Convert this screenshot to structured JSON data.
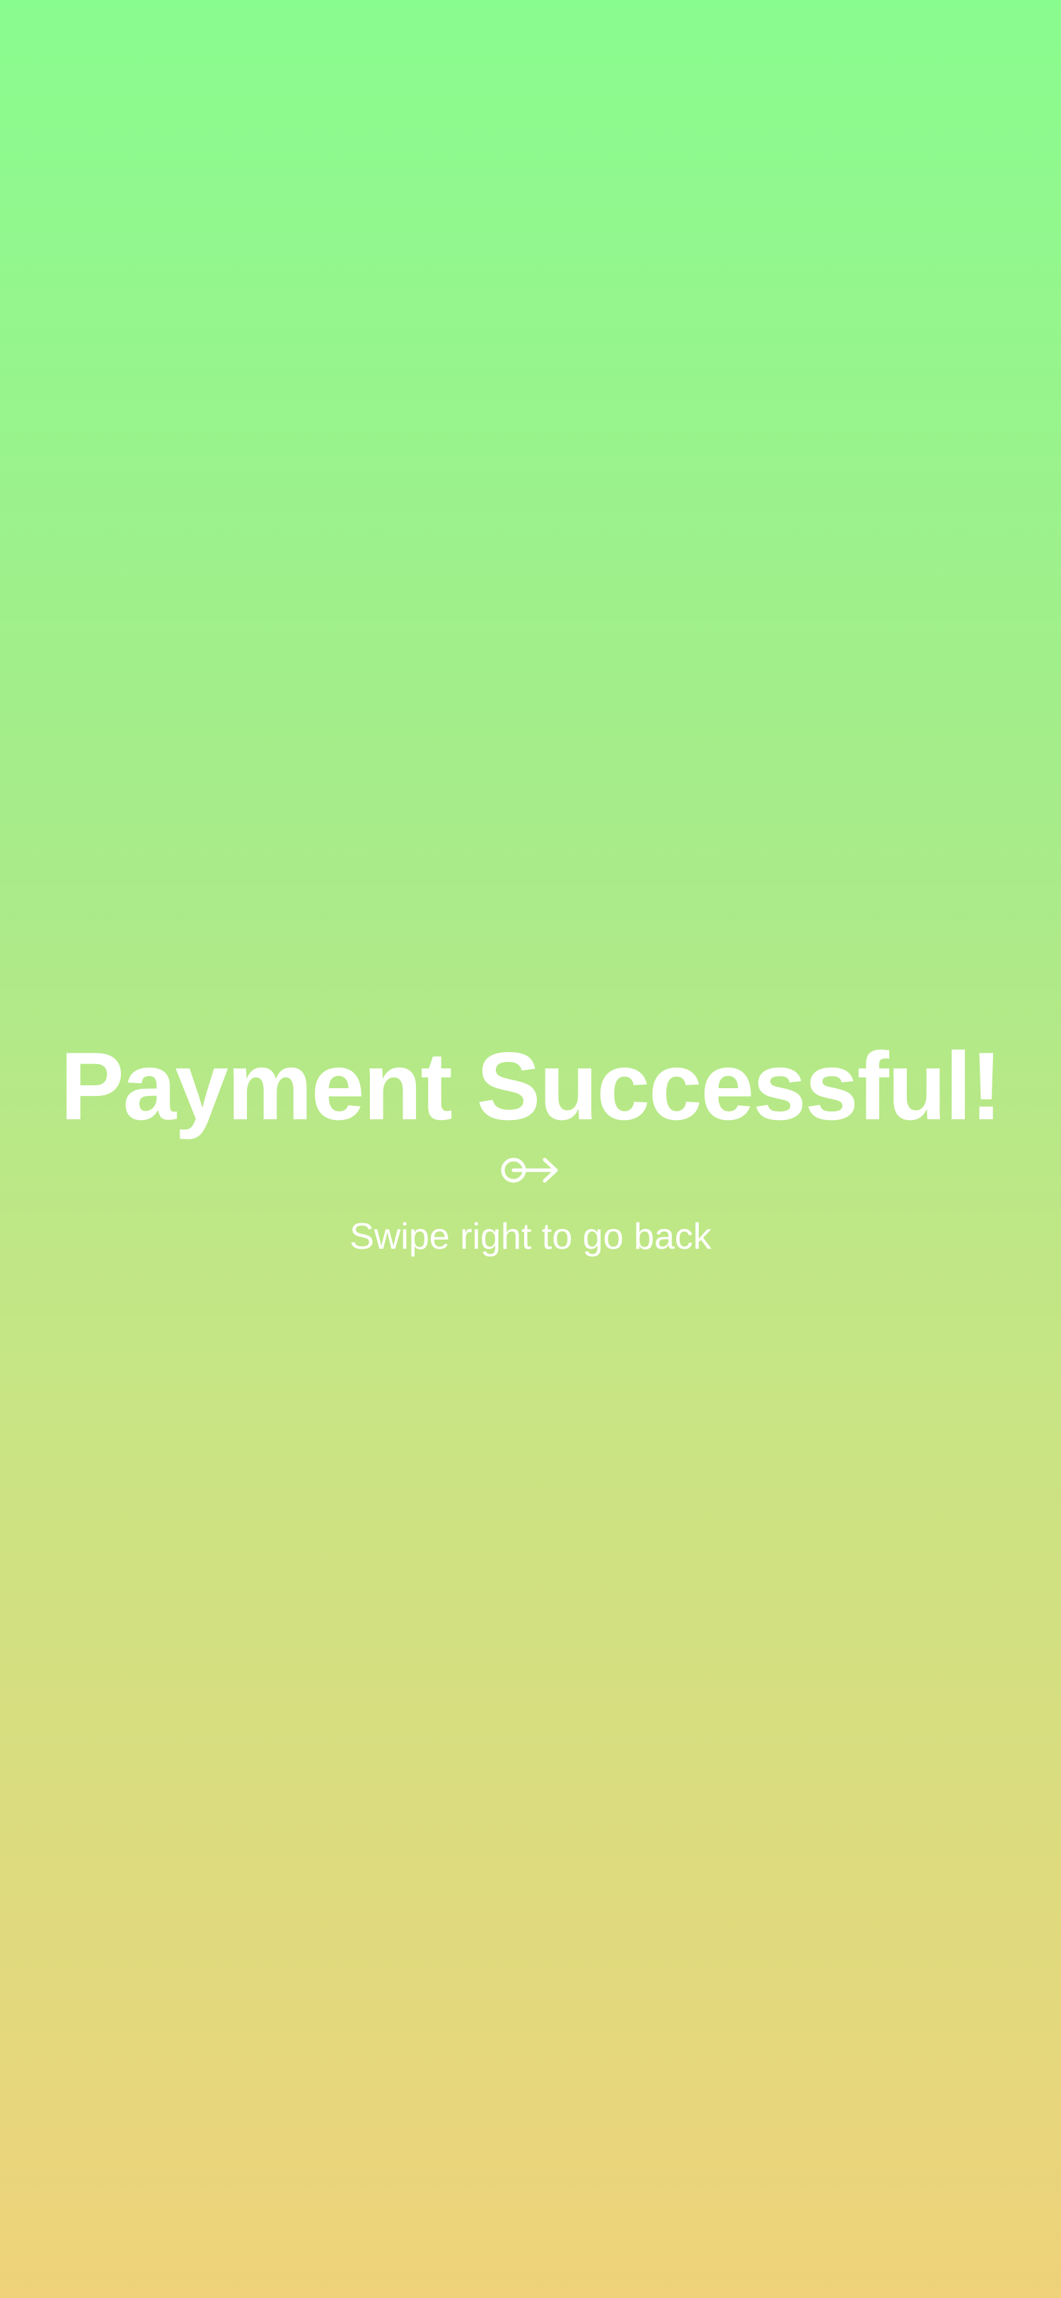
{
  "screen": {
    "title": "Payment Successful!",
    "hint": "Swipe right to go back",
    "icon": "swipe-right-icon"
  },
  "colors": {
    "gradient_top": "#89fc8f",
    "gradient_bottom": "#efd27a",
    "text": "#ffffff"
  }
}
